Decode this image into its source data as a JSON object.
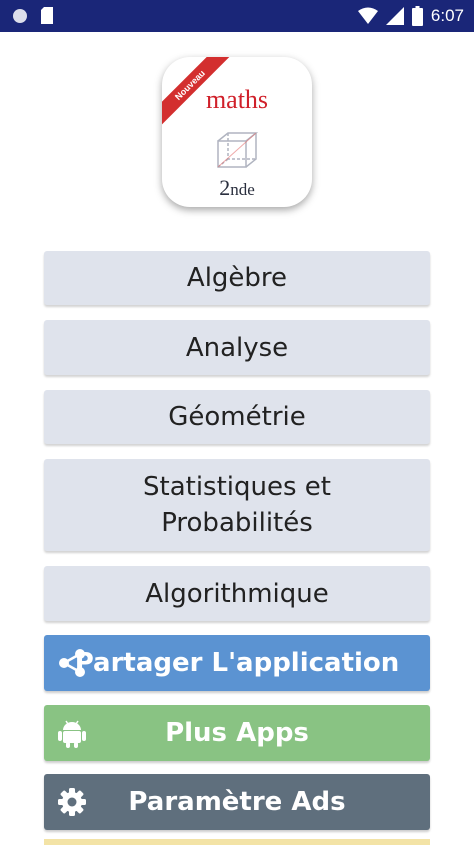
{
  "status_bar": {
    "time": "6:07",
    "icons": [
      "notification-circle-icon",
      "sd-card-icon",
      "wifi-icon",
      "signal-icon",
      "battery-icon"
    ]
  },
  "logo": {
    "ribbon_text": "Nouveau",
    "title": "maths",
    "level_main": "2",
    "level_suffix": "nde"
  },
  "menu": {
    "items": [
      {
        "label": "Algèbre"
      },
      {
        "label": "Analyse"
      },
      {
        "label": "Géométrie"
      },
      {
        "label_line1": "Statistiques et",
        "label_line2": "Probabilités"
      },
      {
        "label": "Algorithmique"
      }
    ]
  },
  "actions": {
    "share": {
      "label": "Partager L'application",
      "icon": "share-icon",
      "color": "#5b93d2"
    },
    "more_apps": {
      "label": "Plus Apps",
      "icon": "android-icon",
      "color": "#89c383"
    },
    "ads_settings": {
      "label": "Paramètre Ads",
      "icon": "gear-icon",
      "color": "#5f6f7d"
    }
  },
  "colors": {
    "status_bar": "#1a2678",
    "menu_button_bg": "#dfe3ec",
    "logo_title": "#d0202a"
  }
}
